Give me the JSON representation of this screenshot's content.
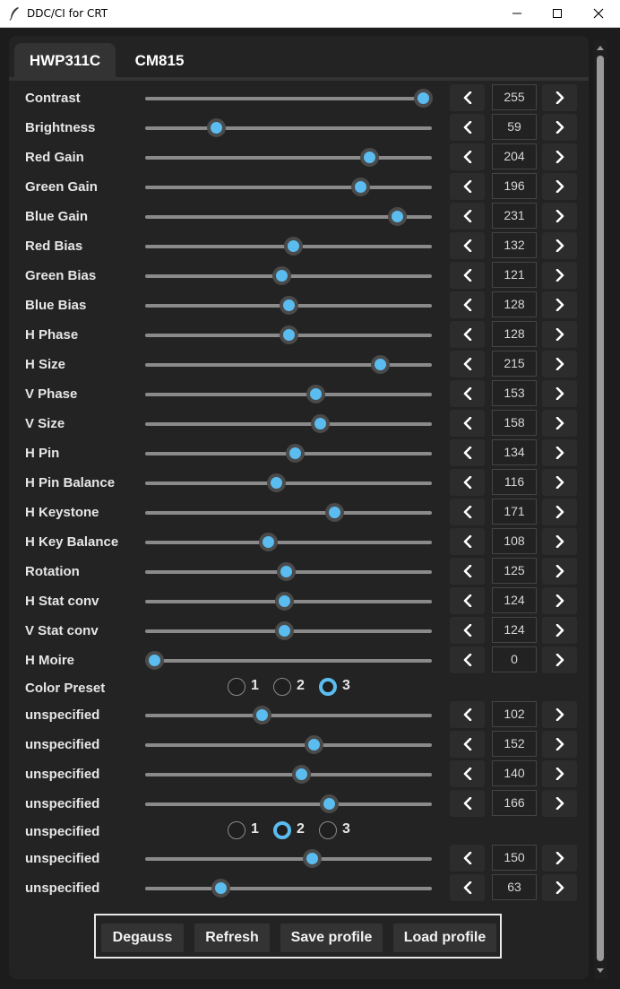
{
  "window": {
    "title": "DDC/CI for CRT"
  },
  "tabs": [
    {
      "label": "HWP311C",
      "active": true
    },
    {
      "label": "CM815",
      "active": false
    }
  ],
  "controls": [
    {
      "label": "Contrast",
      "value": "255"
    },
    {
      "label": "Brightness",
      "value": "59"
    },
    {
      "label": "Red Gain",
      "value": "204"
    },
    {
      "label": "Green Gain",
      "value": "196"
    },
    {
      "label": "Blue Gain",
      "value": "231"
    },
    {
      "label": "Red Bias",
      "value": "132"
    },
    {
      "label": "Green Bias",
      "value": "121"
    },
    {
      "label": "Blue Bias",
      "value": "128"
    },
    {
      "label": "H Phase",
      "value": "128"
    },
    {
      "label": "H Size",
      "value": "215"
    },
    {
      "label": "V Phase",
      "value": "153"
    },
    {
      "label": "V Size",
      "value": "158"
    },
    {
      "label": "H Pin",
      "value": "134"
    },
    {
      "label": "H Pin Balance",
      "value": "116"
    },
    {
      "label": "H Keystone",
      "value": "171"
    },
    {
      "label": "H Key Balance",
      "value": "108"
    },
    {
      "label": "Rotation",
      "value": "125"
    },
    {
      "label": "H Stat conv",
      "value": "124"
    },
    {
      "label": "V Stat conv",
      "value": "124"
    },
    {
      "label": "H Moire",
      "value": "0"
    }
  ],
  "color_preset": {
    "label": "Color Preset",
    "options": [
      "1",
      "2",
      "3"
    ],
    "selected": "3"
  },
  "extra_controls": [
    {
      "label": "unspecified",
      "value": "102"
    },
    {
      "label": "unspecified",
      "value": "152"
    },
    {
      "label": "unspecified",
      "value": "140"
    },
    {
      "label": "unspecified",
      "value": "166"
    }
  ],
  "extra_radio": {
    "label": "unspecified",
    "options": [
      "1",
      "2",
      "3"
    ],
    "selected": "2"
  },
  "extra_controls2": [
    {
      "label": "unspecified",
      "value": "150"
    },
    {
      "label": "unspecified",
      "value": "63"
    }
  ],
  "buttons": {
    "degauss": "Degauss",
    "refresh": "Refresh",
    "save": "Save profile",
    "load": "Load profile"
  },
  "colors": {
    "accent": "#5bbcf0",
    "background": "#1b1b1b",
    "panel": "#232323",
    "button": "#333333"
  },
  "slider_max": 255
}
